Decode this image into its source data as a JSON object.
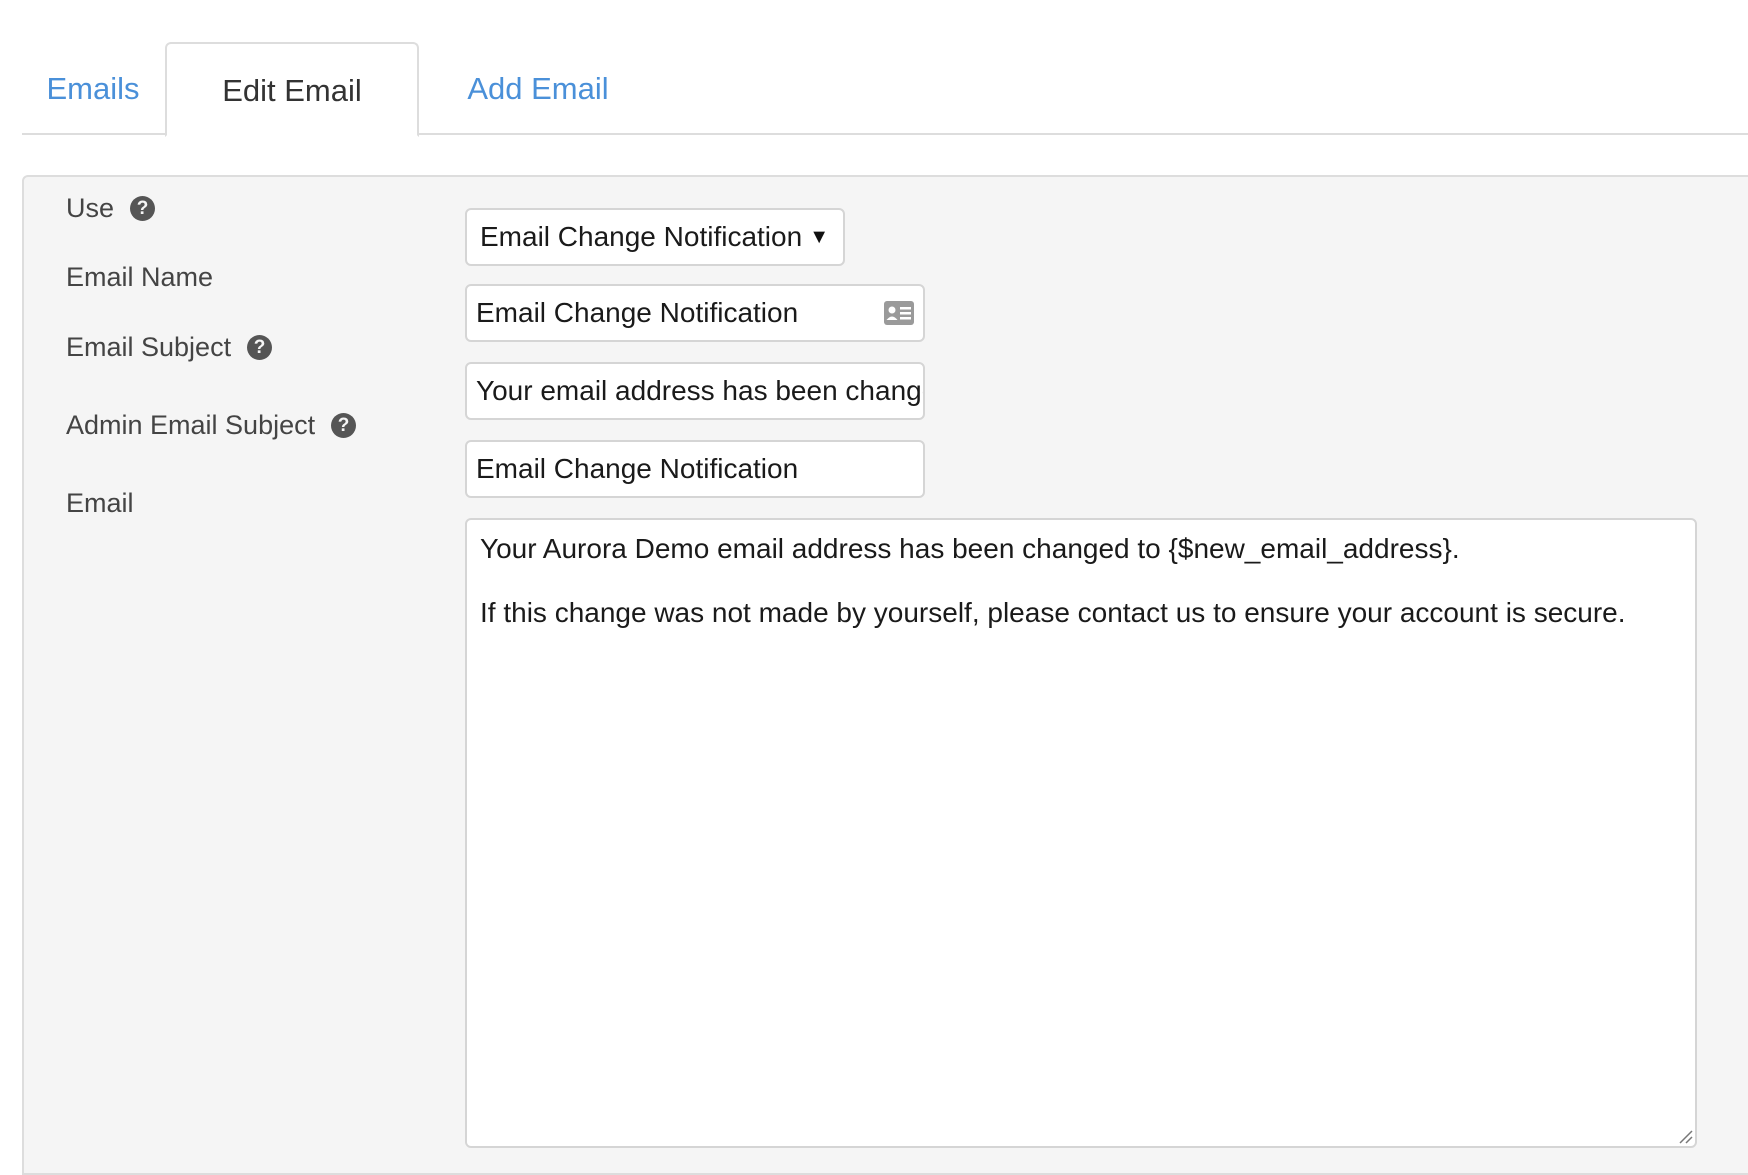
{
  "tabs": [
    {
      "label": "Emails",
      "active": false
    },
    {
      "label": "Edit Email",
      "active": true
    },
    {
      "label": "Add Email",
      "active": false
    }
  ],
  "form": {
    "use": {
      "label": "Use",
      "selected": "Email Change Notification",
      "help_icon": "question-circle-icon"
    },
    "email_name": {
      "label": "Email Name",
      "value": "Email Change Notification",
      "icon": "id-card-icon"
    },
    "email_subject": {
      "label": "Email Subject",
      "value": "Your email address has been changed",
      "help_icon": "question-circle-icon"
    },
    "admin_email_subject": {
      "label": "Admin Email Subject",
      "value": "Email Change Notification",
      "help_icon": "question-circle-icon"
    },
    "email": {
      "label": "Email",
      "paragraphs": [
        "Your Aurora Demo email address has been changed to {$new_email_address}.",
        "If this change was not made by yourself, please contact us to ensure your account is secure."
      ]
    }
  },
  "colors": {
    "link": "#4a90d9",
    "panel_bg": "#f5f5f5",
    "border": "#dddddd"
  }
}
